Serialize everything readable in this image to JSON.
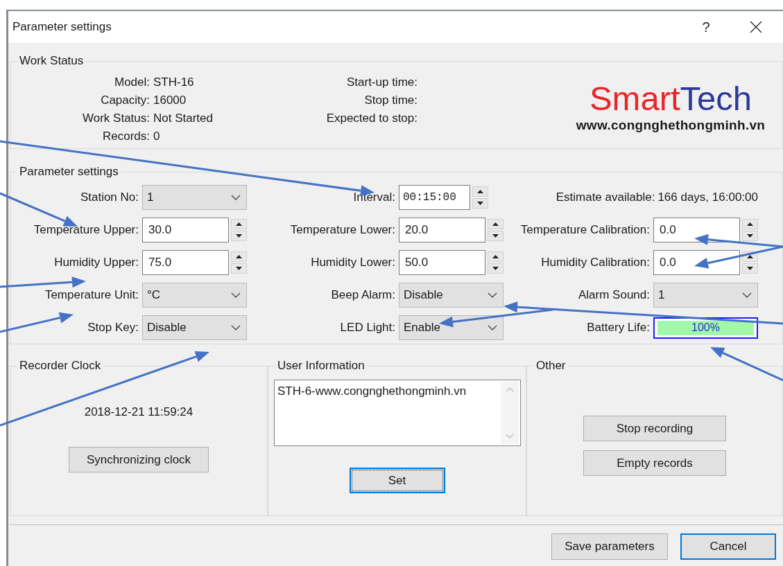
{
  "window": {
    "title": "Parameter settings",
    "help": "?"
  },
  "work_status": {
    "legend": "Work Status",
    "info": [
      {
        "label": "Model:",
        "value": "STH-16"
      },
      {
        "label": "Capacity:",
        "value": "16000"
      },
      {
        "label": "Work Status:",
        "value": "Not Started"
      },
      {
        "label": "Records:",
        "value": "0"
      }
    ],
    "times": [
      {
        "label": "Start-up time:"
      },
      {
        "label": "Stop time:"
      },
      {
        "label": "Expected to stop:"
      }
    ],
    "logo": {
      "words": [
        {
          "text": "Smart",
          "color": "#e8262a"
        },
        {
          "text": "Tech",
          "color": "#2b3a9a"
        }
      ],
      "url": "www.congnghethongminh.vn"
    }
  },
  "parameter_settings": {
    "legend": "Parameter settings",
    "fields": [
      {
        "kind": "combo",
        "label": "Station No:",
        "value": "1"
      },
      {
        "kind": "time",
        "label": "Interval:",
        "value": "00:15:00"
      },
      {
        "kind": "info",
        "label": "Estimate available:",
        "value": "166 days, 16:00:00"
      },
      {
        "kind": "spin",
        "label": "Temperature Upper:",
        "value": "30.0"
      },
      {
        "kind": "spin",
        "label": "Temperature Lower:",
        "value": "20.0"
      },
      {
        "kind": "spin",
        "label": "Temperature Calibration:",
        "value": "0.0"
      },
      {
        "kind": "spin",
        "label": "Humidity Upper:",
        "value": "75.0"
      },
      {
        "kind": "spin",
        "label": "Humidity Lower:",
        "value": "50.0"
      },
      {
        "kind": "spin",
        "label": "Humidity Calibration:",
        "value": "0.0"
      },
      {
        "kind": "combo",
        "label": "Temperature Unit:",
        "value": "°C"
      },
      {
        "kind": "combo",
        "label": "Beep Alarm:",
        "value": "Disable"
      },
      {
        "kind": "combo",
        "label": "Alarm Sound:",
        "value": "1"
      },
      {
        "kind": "combo",
        "label": "Stop Key:",
        "value": "Disable"
      },
      {
        "kind": "combo",
        "label": "LED Light:",
        "value": "Enable"
      },
      {
        "kind": "meter",
        "label": "Battery Life:",
        "level": 1,
        "reading": "100%"
      }
    ]
  },
  "recorder_clock": {
    "legend": "Recorder Clock",
    "time": "2018-12-21 11:59:24",
    "button": {
      "label": "Synchronizing clock",
      "focused": false,
      "default": false
    }
  },
  "user_information": {
    "legend": "User Information",
    "text": "STH-6-www.congnghethongminh.vn",
    "button": {
      "label": "Set",
      "focused": true,
      "default": true
    }
  },
  "other": {
    "legend": "Other",
    "buttons": [
      {
        "label": "Stop recording",
        "focused": false,
        "default": false
      },
      {
        "label": "Empty records",
        "focused": false,
        "default": false
      }
    ]
  },
  "footer_buttons": [
    {
      "label": "Save parameters",
      "focused": false,
      "default": false
    },
    {
      "label": "Cancel",
      "focused": false,
      "default": true
    }
  ]
}
